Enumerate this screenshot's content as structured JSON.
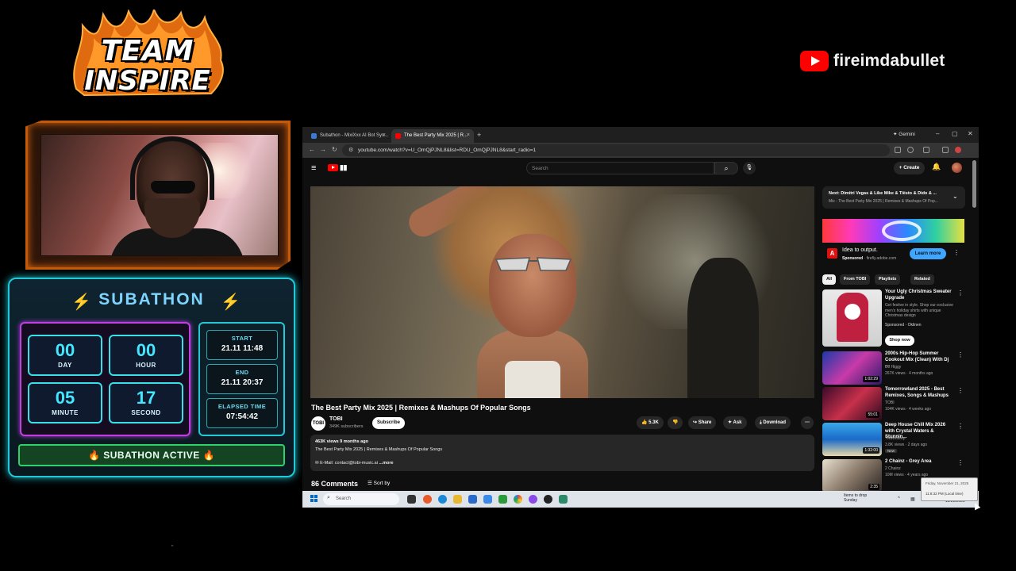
{
  "overlay": {
    "team_logo": {
      "line1": "TEAM",
      "line2": "INSPIRE"
    },
    "youtube_channel": {
      "icon": "youtube-icon",
      "name": "fireimdabullet"
    },
    "subathon": {
      "title": "SUBATHON",
      "icons": [
        "lightning-bolt-icon",
        "lightning-bolt-icon"
      ],
      "countdown": [
        {
          "value": "00",
          "unit": "DAY"
        },
        {
          "value": "00",
          "unit": "HOUR"
        },
        {
          "value": "05",
          "unit": "MINUTE"
        },
        {
          "value": "17",
          "unit": "SECOND"
        }
      ],
      "start": {
        "label": "START",
        "value": "21.11 11:48"
      },
      "end": {
        "label": "END",
        "value": "21.11 20:37"
      },
      "elapsed": {
        "label": "ELAPSED TIME",
        "value": "07:54:42"
      },
      "status": "SUBATHON ACTIVE",
      "status_icon": "fire-emoji",
      "colors": {
        "cyan": "#22c9d8",
        "magenta": "#c23ee0",
        "green": "#2fd16a"
      }
    }
  },
  "browser": {
    "tabs": [
      {
        "title": "Subathon - MixiXxx AI Bot Sys...",
        "active": false
      },
      {
        "title": "The Best Party Mix 2025 | R...",
        "active": true
      }
    ],
    "gemini_label": "Gemini",
    "url": "youtube.com/watch?v=U_OmQjPJNL8&list=RDU_OmQjPJNL8&start_radio=1"
  },
  "youtube": {
    "search_placeholder": "Search",
    "create_label": "Create",
    "video": {
      "title": "The Best Party Mix 2025 | Remixes & Mashups Of Popular Songs",
      "channel": "TOBI",
      "channel_initials": "TOBI",
      "subscribers": "349K subscribers",
      "subscribe_label": "Subscribe",
      "likes": "5.3K",
      "share_label": "Share",
      "ask_label": "Ask",
      "download_label": "Download",
      "meta": "463K views  9 months ago",
      "description": "The Best Party Mix 2025 | Remixes & Mashups Of Popular Songs",
      "email_line": "E-Mail: contact@tobi-music.ai",
      "more_label": "...more",
      "comments_count": "86 Comments",
      "sort_label": "Sort by"
    },
    "next_up": {
      "title": "Next: Dimitri Vegas & Like Mike & Tiësto & Dido & ...",
      "subtitle": "Mix - The Best Party Mix 2025 | Remixes & Mashups Of Pop..."
    },
    "ad": {
      "title": "Idea to output.",
      "sponsored": "Sponsored",
      "domain": "firefly.adobe.com",
      "cta": "Learn more"
    },
    "chips": [
      "All",
      "From TOBI",
      "Playlists",
      "Related"
    ],
    "recommendations": [
      {
        "title": "Your Ugly Christmas Sweater Upgrade",
        "channel": "Get festive in style. Shop our exclusive men's holiday shirts with unique Christmas design",
        "meta": "Sponsored · Oklinen",
        "duration": "",
        "cta": "Shop now"
      },
      {
        "title": "2000s Hip-Hop Summer Cookout Mix (Clean) With Dj ...",
        "channel": "DJ Higgy",
        "meta": "267K views · 4 months ago",
        "duration": "1:02:29"
      },
      {
        "title": "Tomorrowland 2025 - Best Remixes, Songs & Mashups",
        "channel": "TOBI",
        "meta": "104K views · 4 weeks ago",
        "duration": "55:01"
      },
      {
        "title": "Deep House Chill Mix 2026 with Crystal Waters & Stunnin...",
        "channel": "7wavedeep",
        "meta": "3.8K views · 2 days ago",
        "duration": "1:32:00",
        "badge": "New"
      },
      {
        "title": "2 Chainz - Grey Area",
        "channel": "2 Chainz",
        "meta": "10M views · 4 years ago",
        "duration": "2:35"
      }
    ]
  },
  "taskbar": {
    "search_placeholder": "Search",
    "weather_line1": "Items to drop",
    "weather_line2": "Sunday",
    "date": "11/21/2025",
    "tooltip_line1": "Friday, November 21, 2025",
    "tooltip_line2": "11:8:32 PM (Local time)"
  }
}
